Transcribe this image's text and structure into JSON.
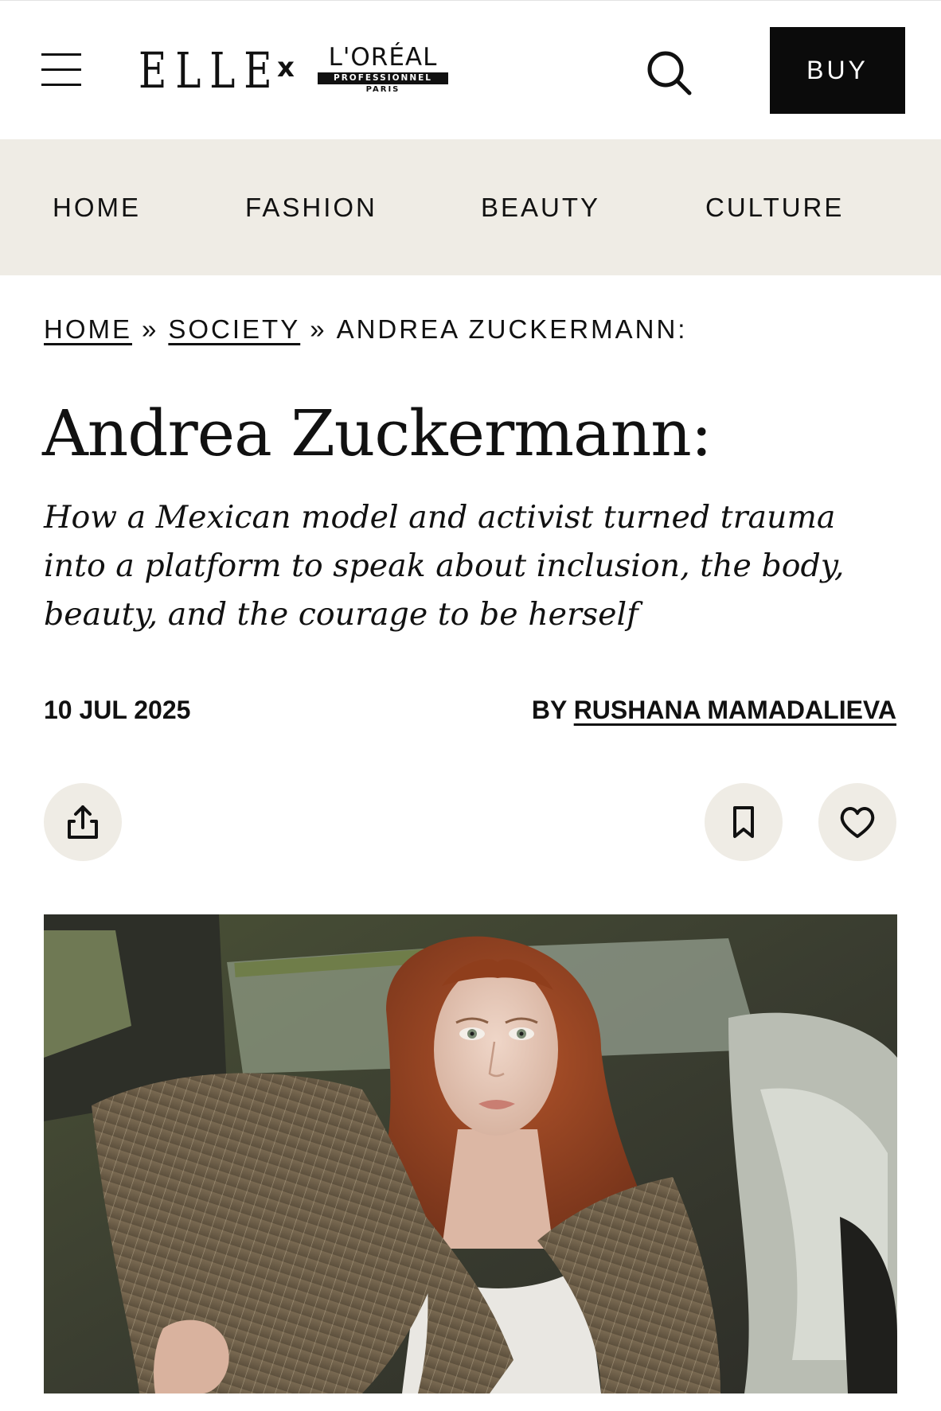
{
  "header": {
    "menu_icon": "hamburger-menu-icon",
    "brand_elle": "ELLE",
    "brand_separator": "x",
    "partner": {
      "name": "L'ORÉAL",
      "line2": "PROFESSIONNEL",
      "line3": "PARIS"
    },
    "search_icon": "search-icon",
    "buy_label": "BUY"
  },
  "nav": {
    "items": [
      {
        "label": "HOME"
      },
      {
        "label": "FASHION"
      },
      {
        "label": "BEAUTY"
      },
      {
        "label": "CULTURE"
      }
    ]
  },
  "breadcrumb": {
    "items": [
      {
        "label": "HOME"
      },
      {
        "label": "SOCIETY"
      },
      {
        "label": "ANDREA ZUCKERMANN:"
      }
    ],
    "separator": "»"
  },
  "article": {
    "title": "Andrea Zuckermann:",
    "subtitle": "How a Mexican model and activist turned trauma into a platform to speak about inclusion, the body, beauty, and the courage to be herself",
    "date": "10 JUL 2025",
    "by_prefix": "BY",
    "author": "RUSHANA MAMADALIEVA"
  },
  "actions": {
    "share_icon": "share-icon",
    "bookmark_icon": "bookmark-icon",
    "like_icon": "heart-icon"
  },
  "colors": {
    "nav_background": "#efece5",
    "buy_background": "#0b0b0b",
    "text": "#111111"
  }
}
